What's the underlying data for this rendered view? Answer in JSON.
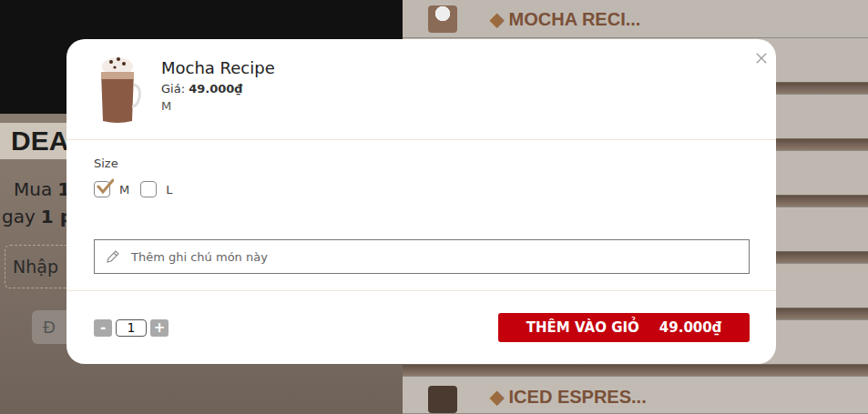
{
  "background": {
    "banner": "DEAL",
    "promo_lines": [
      {
        "parts": [
          {
            "text": "Mua",
            "bold": false
          },
          {
            "text": "1",
            "bold": true
          }
        ]
      },
      {
        "parts": [
          {
            "text": "gay",
            "bold": false
          },
          {
            "text": "1 p",
            "bold": true
          }
        ]
      }
    ],
    "code_input": {
      "placeholder": "Nhập"
    },
    "button": "Đ",
    "menu_items": [
      {
        "marker": "◆",
        "name": "MOCHA RECI..."
      },
      {
        "marker": "◆",
        "name": "ICED ESPRES..."
      }
    ]
  },
  "dialog": {
    "product": {
      "name": "Mocha Recipe",
      "price_label": "Giá:",
      "price": "49.000₫",
      "size": "M"
    },
    "size_group": {
      "label": "Size",
      "options": [
        {
          "label": "M",
          "selected": true
        },
        {
          "label": "L",
          "selected": false
        }
      ]
    },
    "note": {
      "placeholder": "Thêm ghi chú món này"
    },
    "quantity": {
      "minus": "-",
      "value": "1",
      "plus": "+"
    },
    "add_button": {
      "label": "THÊM VÀO GIỎ",
      "total": "49.000₫"
    }
  }
}
